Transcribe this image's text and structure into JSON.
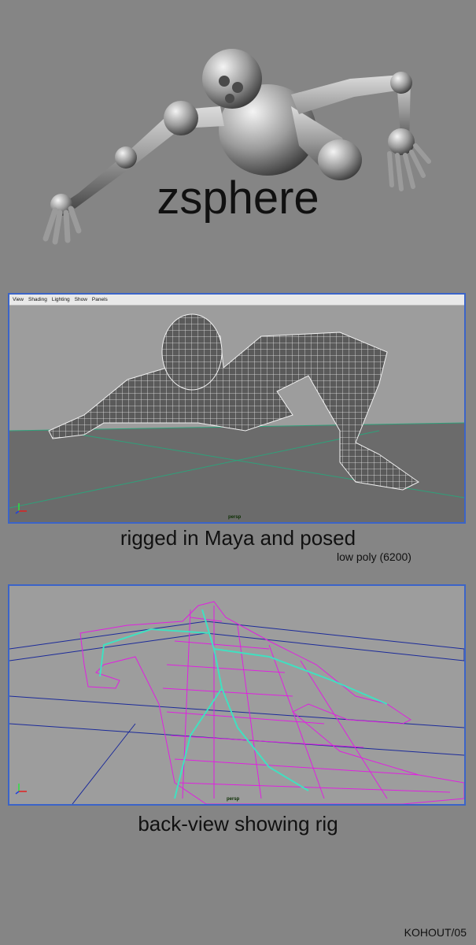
{
  "section_zsphere": {
    "caption": "zsphere"
  },
  "viewport_top": {
    "menu": [
      "View",
      "Shading",
      "Lighting",
      "Show",
      "Panels"
    ],
    "camera_label": "persp"
  },
  "caption_maya": "rigged in Maya and posed",
  "caption_poly": "low poly (6200)",
  "viewport_bottom": {
    "camera_label": "persp"
  },
  "caption_rig": "back-view showing rig",
  "signature": "KOHOUT/05",
  "colors": {
    "background": "#858585",
    "viewport_border": "#3b64c8",
    "wireframe_rig": "#e020e0",
    "skeleton": "#40e0c0",
    "grid_line": "#2fa07a"
  }
}
